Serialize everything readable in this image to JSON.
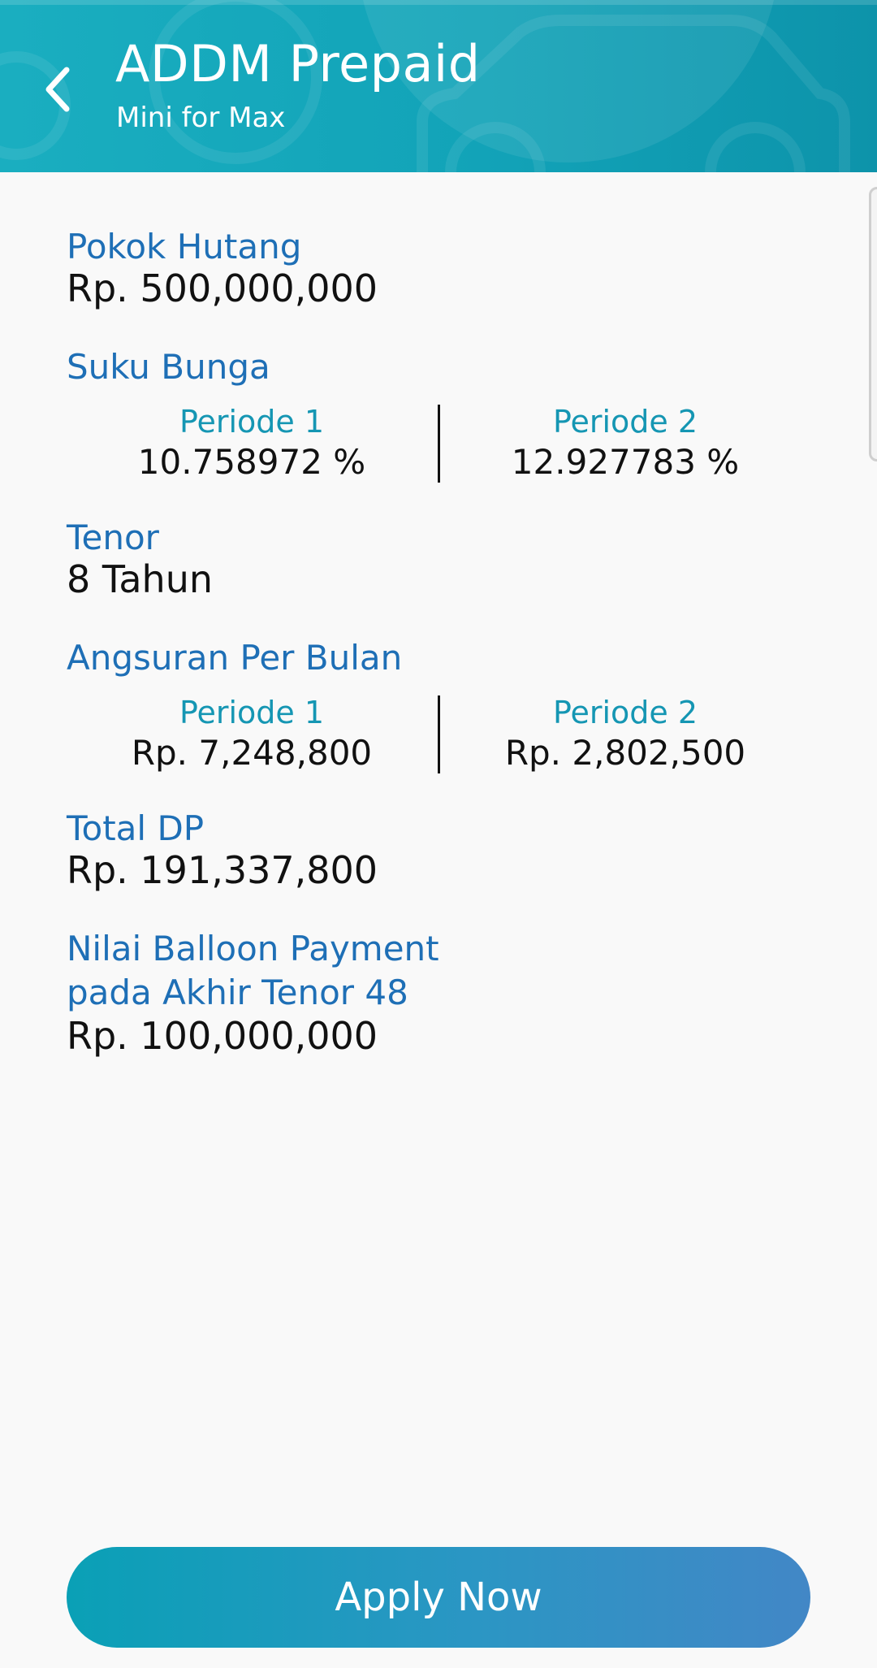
{
  "header": {
    "title": "ADDM Prepaid",
    "subtitle": "Mini for Max",
    "back_icon": "chevron-left-icon",
    "background_color": "#12a3b8"
  },
  "loan": {
    "pokok_hutang": {
      "label": "Pokok Hutang",
      "value": "Rp. 500,000,000"
    },
    "suku_bunga": {
      "label": "Suku Bunga",
      "periode_1": {
        "label": "Periode 1",
        "value": "10.758972 %"
      },
      "periode_2": {
        "label": "Periode 2",
        "value": "12.927783 %"
      }
    },
    "tenor": {
      "label": "Tenor",
      "value": "8 Tahun"
    },
    "angsuran": {
      "label": "Angsuran Per Bulan",
      "periode_1": {
        "label": "Periode 1",
        "value": "Rp. 7,248,800"
      },
      "periode_2": {
        "label": "Periode 2",
        "value": "Rp. 2,802,500"
      }
    },
    "total_dp": {
      "label": "Total DP",
      "value": "Rp. 191,337,800"
    },
    "balloon": {
      "label_line1": "Nilai Balloon Payment",
      "label_line2": "pada Akhir Tenor 48",
      "value": "Rp. 100,000,000"
    }
  },
  "actions": {
    "apply_label": "Apply Now"
  },
  "colors": {
    "label": "#1e6fb6",
    "period_label": "#1596b3",
    "value": "#111111",
    "button_start": "#0aa0b6",
    "button_end": "#4287c6"
  }
}
